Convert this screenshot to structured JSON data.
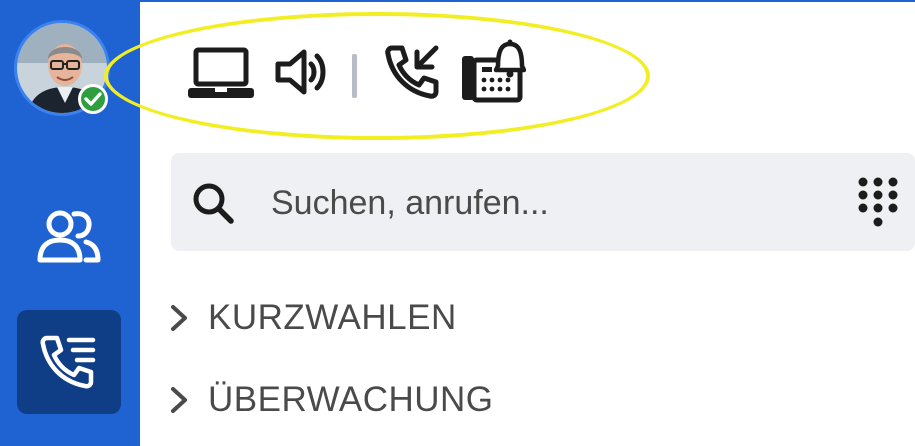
{
  "user": {
    "status": "online"
  },
  "sidebar": {
    "items": [
      {
        "name": "contacts",
        "icon": "contacts-icon",
        "active": false
      },
      {
        "name": "calls",
        "icon": "phone-list-icon",
        "active": true
      }
    ]
  },
  "toolbar": {
    "icons": [
      "laptop-icon",
      "speaker-icon",
      "incoming-call-icon",
      "deskphone-bell-icon"
    ]
  },
  "search": {
    "placeholder": "Suchen, anrufen..."
  },
  "sections": [
    {
      "label": "KURZWAHLEN"
    },
    {
      "label": "ÜBERWACHUNG"
    }
  ],
  "colors": {
    "sidebar": "#1f63d2",
    "active_nav": "#0f3d86",
    "highlight": "#f2ee24",
    "status_online": "#2e9e3f"
  }
}
